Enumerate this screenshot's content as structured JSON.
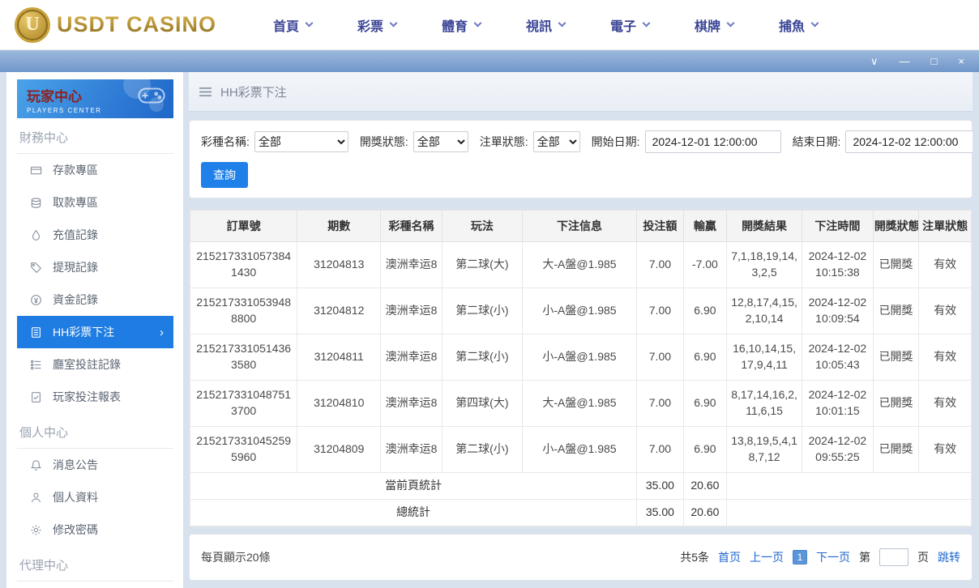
{
  "colors": {
    "accent": "#1e7ce2",
    "brand_gold": "#b08d2f",
    "link": "#1e66d0",
    "active_menu": "#1e7ce2"
  },
  "icons": {
    "logo_letter": "U",
    "window_chevron": "∨",
    "window_minimize": "—",
    "window_maximize": "□",
    "window_close": "×",
    "active_arrow": "›"
  },
  "header": {
    "brand": "USDT CASINO",
    "nav": [
      {
        "label": "首頁"
      },
      {
        "label": "彩票"
      },
      {
        "label": "體育"
      },
      {
        "label": "視訊"
      },
      {
        "label": "電子"
      },
      {
        "label": "棋牌"
      },
      {
        "label": "捕魚"
      }
    ]
  },
  "sidebar": {
    "title": "玩家中心",
    "subtitle": "PLAYERS CENTER",
    "sections": [
      {
        "label": "財務中心",
        "items": [
          {
            "label": "存款專區",
            "icon": "deposit-card-icon"
          },
          {
            "label": "取款專區",
            "icon": "coins-icon"
          },
          {
            "label": "充值記錄",
            "icon": "droplet-icon"
          },
          {
            "label": "提現記錄",
            "icon": "tag-icon"
          },
          {
            "label": "資金記錄",
            "icon": "funds-icon"
          },
          {
            "label": "HH彩票下注",
            "icon": "lottery-list-icon",
            "active": true
          },
          {
            "label": "廳室投註記錄",
            "icon": "hall-records-icon"
          },
          {
            "label": "玩家投注報表",
            "icon": "report-icon"
          }
        ]
      },
      {
        "label": "個人中心",
        "items": [
          {
            "label": "消息公告",
            "icon": "bell-icon"
          },
          {
            "label": "個人資料",
            "icon": "person-icon"
          },
          {
            "label": "修改密碼",
            "icon": "gear-icon"
          }
        ]
      },
      {
        "label": "代理中心",
        "items": []
      }
    ]
  },
  "breadcrumb": {
    "title": "HH彩票下注"
  },
  "filters": {
    "lottery_label": "彩種名稱:",
    "lottery_value": "全部",
    "draw_label": "開獎狀態:",
    "draw_value": "全部",
    "bet_label": "注單狀態:",
    "bet_value": "全部",
    "start_label": "開始日期:",
    "start_value": "2024-12-01 12:00:00",
    "end_label": "結束日期:",
    "end_value": "2024-12-02 12:00:00",
    "search": "查詢"
  },
  "table": {
    "headers": [
      "訂單號",
      "期數",
      "彩種名稱",
      "玩法",
      "下注信息",
      "投注額",
      "輸贏",
      "開獎結果",
      "下注時間",
      "開獎狀態",
      "注單狀態"
    ],
    "rows": [
      [
        "2152173310573841430",
        "31204813",
        "澳洲幸运8",
        "第二球(大)",
        "大-A盤@1.985",
        "7.00",
        "-7.00",
        "7,1,18,19,14,3,2,5",
        "2024-12-02 10:15:38",
        "已開獎",
        "有效"
      ],
      [
        "2152173310539488800",
        "31204812",
        "澳洲幸运8",
        "第二球(小)",
        "小-A盤@1.985",
        "7.00",
        "6.90",
        "12,8,17,4,15,2,10,14",
        "2024-12-02 10:09:54",
        "已開獎",
        "有效"
      ],
      [
        "2152173310514363580",
        "31204811",
        "澳洲幸运8",
        "第二球(小)",
        "小-A盤@1.985",
        "7.00",
        "6.90",
        "16,10,14,15,17,9,4,11",
        "2024-12-02 10:05:43",
        "已開獎",
        "有效"
      ],
      [
        "2152173310487513700",
        "31204810",
        "澳洲幸运8",
        "第四球(大)",
        "大-A盤@1.985",
        "7.00",
        "6.90",
        "8,17,14,16,2,11,6,15",
        "2024-12-02 10:01:15",
        "已開獎",
        "有效"
      ],
      [
        "2152173310452595960",
        "31204809",
        "澳洲幸运8",
        "第二球(小)",
        "小-A盤@1.985",
        "7.00",
        "6.90",
        "13,8,19,5,4,18,7,12",
        "2024-12-02 09:55:25",
        "已開獎",
        "有效"
      ]
    ],
    "summary": [
      {
        "label": "當前頁統計",
        "bet": "35.00",
        "win": "20.60"
      },
      {
        "label": "總統計",
        "bet": "35.00",
        "win": "20.60"
      }
    ]
  },
  "pagination": {
    "page_size_text": "每頁顯示20條",
    "total_text": "共5条",
    "first": "首页",
    "prev": "上一页",
    "current": "1",
    "next": "下一页",
    "jump_before": "第",
    "jump_after": "页",
    "jump_button": "跳转"
  }
}
